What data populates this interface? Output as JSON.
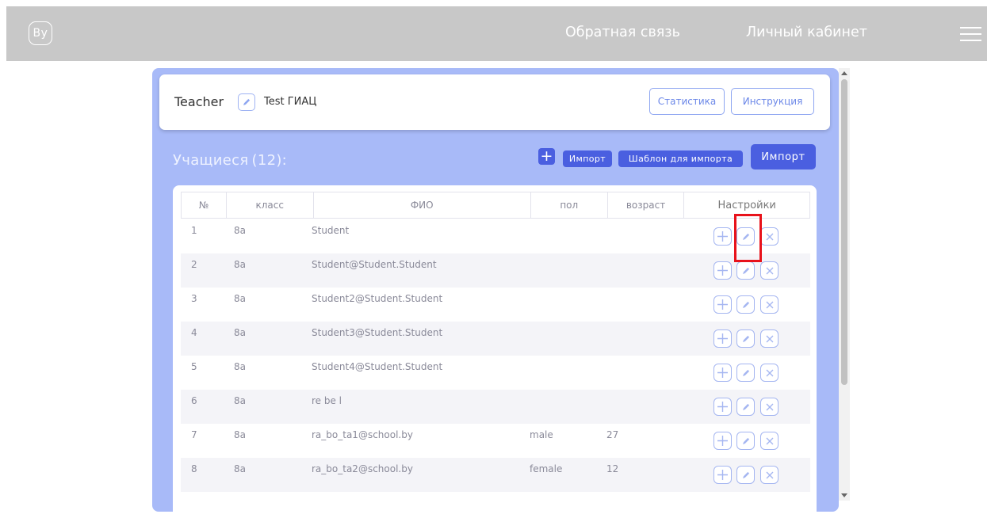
{
  "header": {
    "logo_text": "By",
    "nav_feedback": "Обратная связь",
    "nav_cabinet": "Личный кабинет",
    "menu_icon": "hamburger-icon"
  },
  "teacher": {
    "label": "Teacher",
    "name": "Test ГИАЦ",
    "stats_button": "Статистика",
    "instruction_button": "Инструкция"
  },
  "students": {
    "title": "Учащиеся",
    "count": "(12):",
    "add_button": "+",
    "import_small_button": "Импорт",
    "template_button": "Шаблон для импорта",
    "import_button": "Импорт"
  },
  "table": {
    "columns": [
      "№",
      "класс",
      "ФИО",
      "пол",
      "возраст",
      "Настройки"
    ],
    "rows": [
      {
        "n": "1",
        "cls": "8а",
        "fio": "Student",
        "sex": "",
        "age": ""
      },
      {
        "n": "2",
        "cls": "8а",
        "fio": "Student@Student.Student",
        "sex": "",
        "age": ""
      },
      {
        "n": "3",
        "cls": "8а",
        "fio": "Student2@Student.Student",
        "sex": "",
        "age": ""
      },
      {
        "n": "4",
        "cls": "8а",
        "fio": "Student3@Student.Student",
        "sex": "",
        "age": ""
      },
      {
        "n": "5",
        "cls": "8а",
        "fio": "Student4@Student.Student",
        "sex": "",
        "age": ""
      },
      {
        "n": "6",
        "cls": "8а",
        "fio": "re be l",
        "sex": "",
        "age": ""
      },
      {
        "n": "7",
        "cls": "8а",
        "fio": "ra_bo_ta1@school.by",
        "sex": "male",
        "age": "27"
      },
      {
        "n": "8",
        "cls": "8а",
        "fio": "ra_bo_ta2@school.by",
        "sex": "female",
        "age": "12"
      }
    ],
    "row_actions": [
      "plus-icon",
      "pencil-icon",
      "close-icon"
    ]
  },
  "colors": {
    "header_bg": "#c8c8c8",
    "panel_bg": "#a8baf8",
    "primary_button": "#4a5fe0",
    "highlight": "#e8121b"
  }
}
